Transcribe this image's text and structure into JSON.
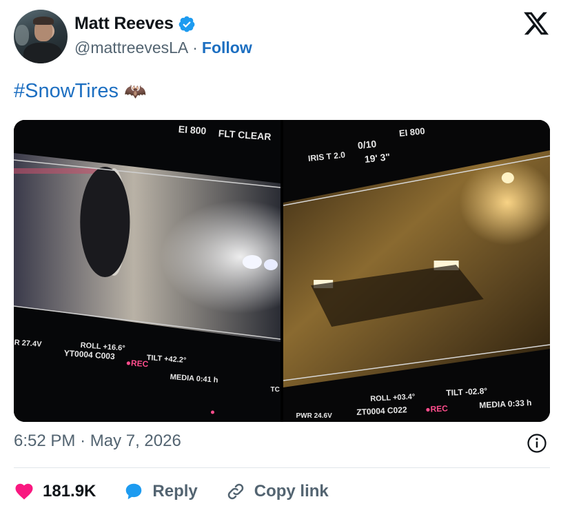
{
  "author": {
    "name": "Matt Reeves",
    "handle": "@mattreevesLA",
    "separator": "·",
    "follow_label": "Follow"
  },
  "tweet": {
    "text": "#SnowTires",
    "emoji": "🦇"
  },
  "media": {
    "left": {
      "ei": "EI 800",
      "flt": "FLT CLEAR",
      "pwr": "R 27.4V",
      "roll": "ROLL +16.6°",
      "clip": "YT0004 C003",
      "rec": "●REC",
      "tilt": "TILT +42.2°",
      "media": "MEDIA 0:41 h",
      "tc": "TC"
    },
    "right": {
      "iris": "IRIS T 2.0",
      "shutter": "0/10",
      "focus": "19'  3\"",
      "ei": "EI 800",
      "pwr": "PWR 24.6V",
      "roll": "ROLL +03.4°",
      "clip": "ZT0004 C022",
      "rec": "●REC",
      "tilt": "TILT -02.8°",
      "media": "MEDIA 0:33 h"
    }
  },
  "meta": {
    "time": "6:52 PM",
    "date": "May 7, 2026",
    "separator": "·"
  },
  "actions": {
    "likes": "181.9K",
    "reply": "Reply",
    "copy_link": "Copy link"
  },
  "colors": {
    "link_blue": "#1d6fc1",
    "like_red": "#f91880",
    "reply_blue": "#1d9bf0",
    "muted": "#536471"
  }
}
